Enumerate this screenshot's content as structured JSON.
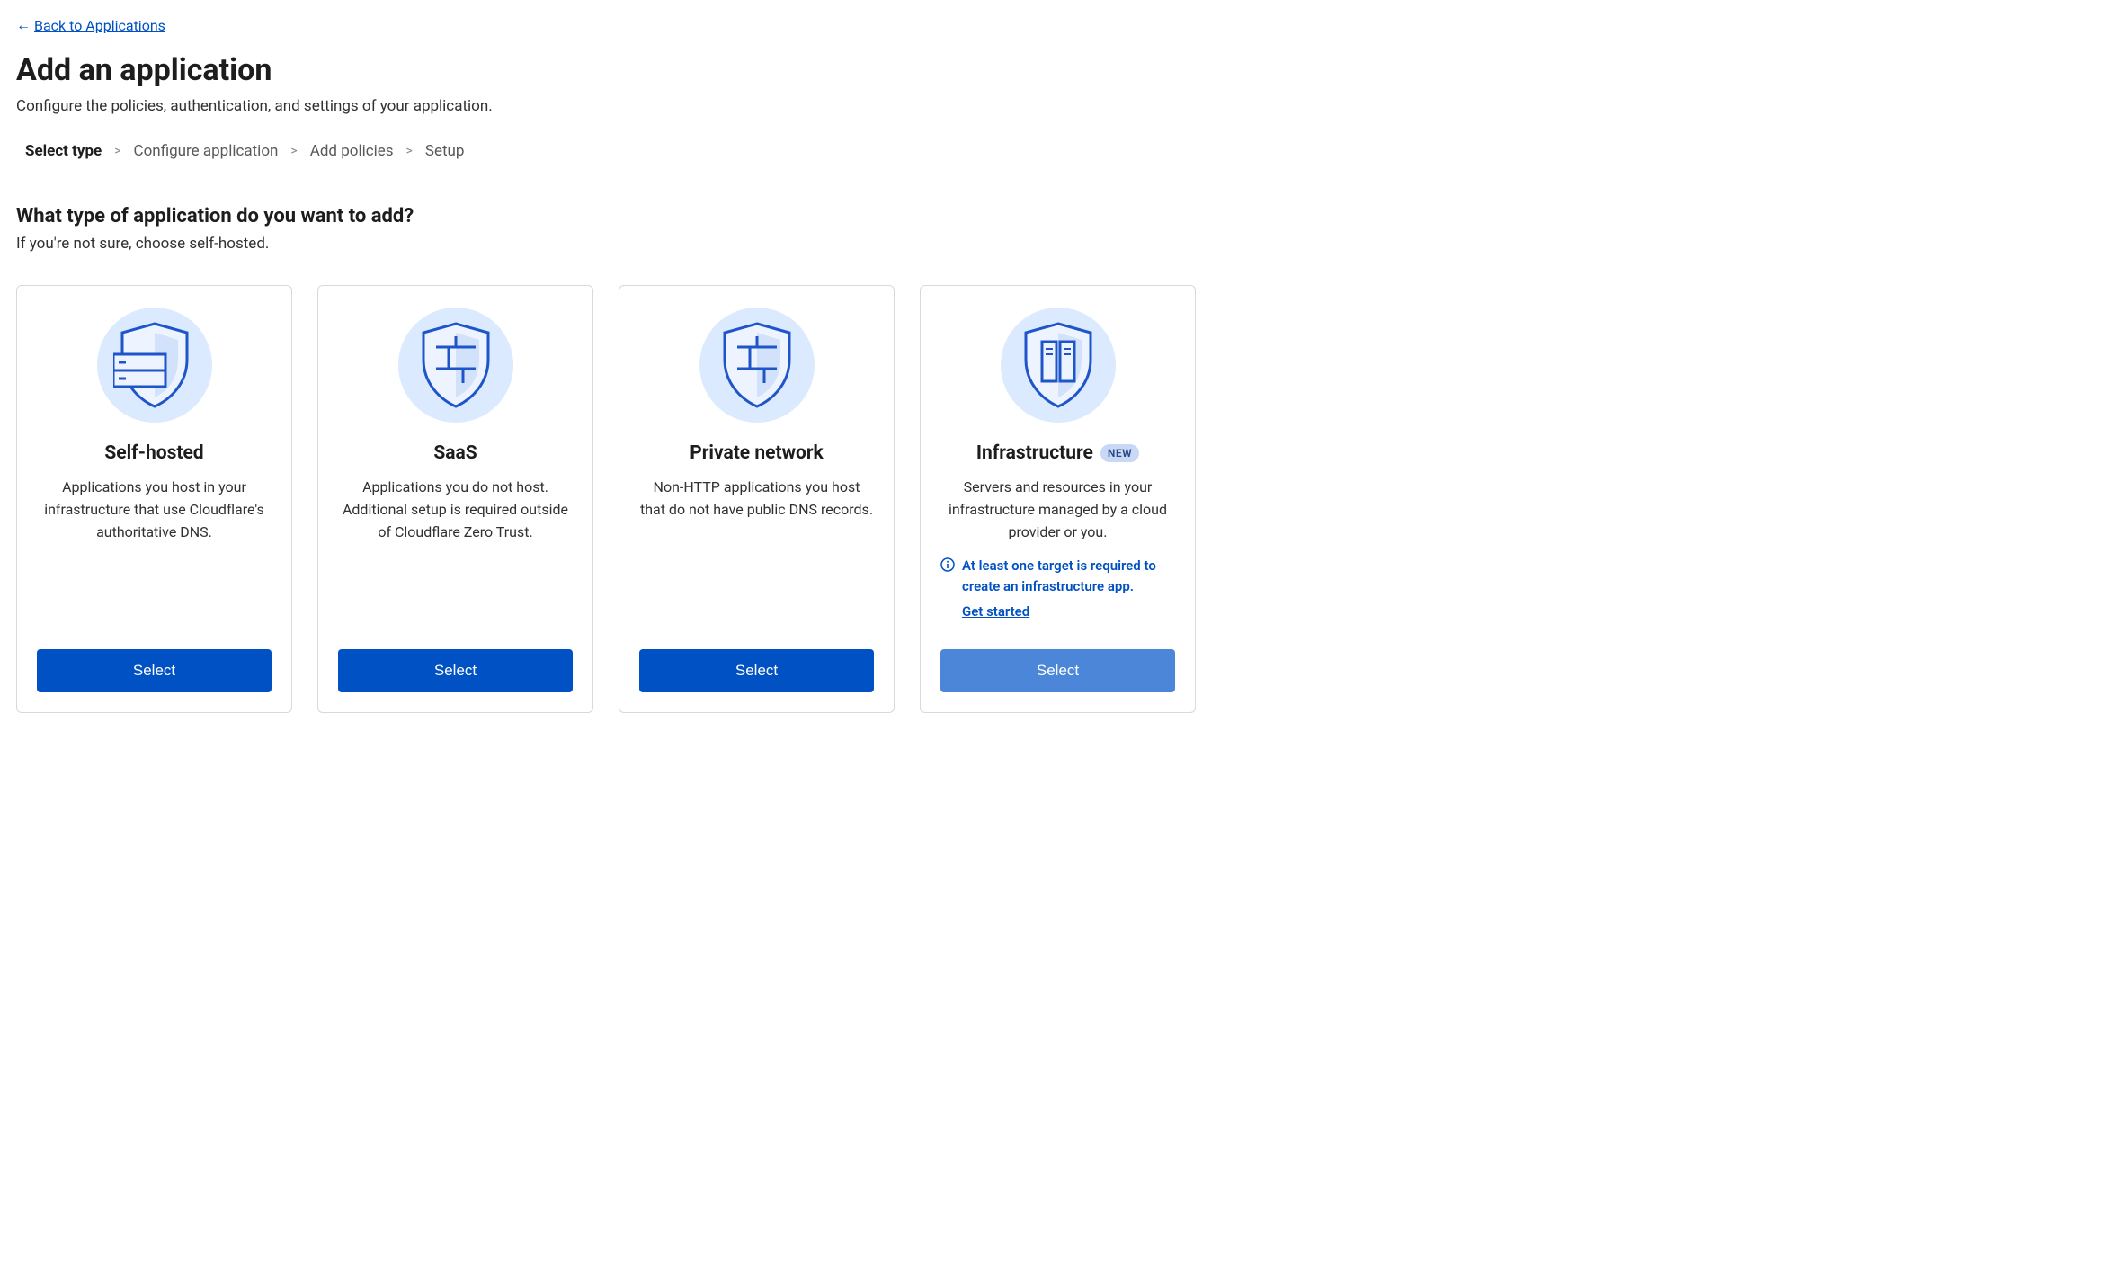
{
  "back_link": "Back to Applications",
  "page_title": "Add an application",
  "page_subtitle": "Configure the policies, authentication, and settings of your application.",
  "breadcrumb": {
    "steps": [
      "Select type",
      "Configure application",
      "Add policies",
      "Setup"
    ],
    "separator": ">"
  },
  "section_title": "What type of application do you want to add?",
  "section_hint": "If you're not sure, choose self-hosted.",
  "cards": [
    {
      "title": "Self-hosted",
      "desc": "Applications you host in your infrastructure that use Cloudflare's authoritative DNS.",
      "select": "Select"
    },
    {
      "title": "SaaS",
      "desc": "Applications you do not host. Additional setup is required outside of Cloudflare Zero Trust.",
      "select": "Select"
    },
    {
      "title": "Private network",
      "desc": "Non-HTTP applications you host that do not have public DNS records.",
      "select": "Select"
    },
    {
      "title": "Infrastructure",
      "badge": "NEW",
      "desc": "Servers and resources in your infrastructure managed by a cloud provider or you.",
      "notice": "At least one target is required to create an infrastructure app.",
      "notice_link": "Get started",
      "select": "Select"
    }
  ]
}
